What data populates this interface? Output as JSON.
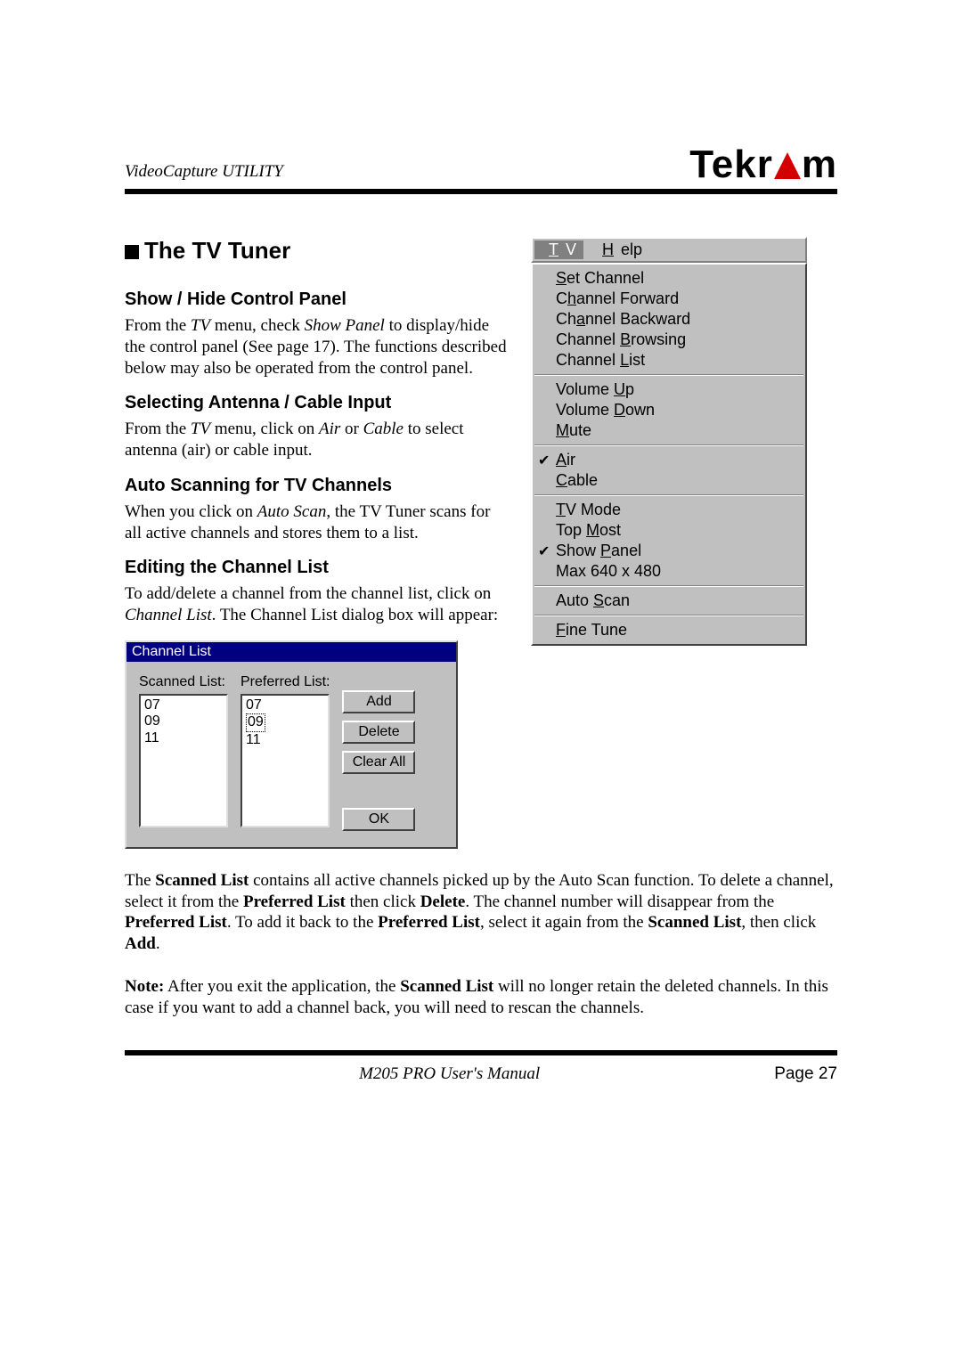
{
  "header": {
    "caption": "VideoCapture UTILITY",
    "brand_left": "Tekr",
    "brand_right": "m"
  },
  "section": {
    "title": "The TV Tuner"
  },
  "sub": {
    "showhide": {
      "h": "Show / Hide Control Panel",
      "p1a": "From the ",
      "p1b": "TV",
      "p1c": " menu, check  ",
      "p1d": "Show Panel",
      "p1e": " to display/hide the control panel (See page 17). The functions described below may also be operated from the control panel."
    },
    "ant": {
      "h": "Selecting Antenna / Cable Input",
      "p1a": "From the ",
      "p1b": "TV",
      "p1c": " menu, click on ",
      "p1d": "Air",
      "p1e": " or ",
      "p1f": "Cable",
      "p1g": " to select antenna (air) or cable input."
    },
    "scan": {
      "h": "Auto Scanning for TV Channels",
      "p1a": "When you click on ",
      "p1b": "Auto Scan",
      "p1c": ", the TV Tuner scans for all active channels and stores them to a list."
    },
    "edit": {
      "h": "Editing the Channel List",
      "p1a": "To add/delete a channel from the channel list, click on ",
      "p1b": "Channel List",
      "p1c": ". The Channel List dialog box will appear:"
    }
  },
  "menu": {
    "bar": {
      "tv": "TV",
      "help": "Help"
    },
    "items": {
      "set_channel": "Set Channel",
      "ch_forward": "Channel Forward",
      "ch_backward": "Channel Backward",
      "ch_browsing": "Channel Browsing",
      "ch_list": "Channel List",
      "vol_up": "Volume Up",
      "vol_down": "Volume Down",
      "mute": "Mute",
      "air": "Air",
      "cable": "Cable",
      "tv_mode": "TV Mode",
      "top_most": "Top Most",
      "show_panel": "Show Panel",
      "max_res": "Max 640 x 480",
      "auto_scan": "Auto Scan",
      "fine_tune": "Fine Tune"
    }
  },
  "dialog": {
    "title": "Channel List",
    "scanned_label": "Scanned List:",
    "preferred_label": "Preferred List:",
    "scanned": [
      "07",
      "09",
      "11"
    ],
    "preferred": [
      "07",
      "09",
      "11"
    ],
    "buttons": {
      "add": "Add",
      "delete": "Delete",
      "clear": "Clear All",
      "ok": "OK"
    }
  },
  "lower1": {
    "a": "The ",
    "b": "Scanned List",
    "c": " contains all active channels picked up by the Auto Scan function. To delete a channel, select it from the ",
    "d": "Preferred List",
    "e": " then click ",
    "f": "Delete",
    "g": ". The channel number will disappear from the ",
    "h": "Preferred List",
    "i": ". To add it back to the ",
    "j": "Preferred List",
    "k": ", select it again from the ",
    "l": "Scanned List",
    "m": ", then click ",
    "n": "Add",
    "o": "."
  },
  "lower2": {
    "a": "Note:",
    "b": " After you exit the application, the ",
    "c": "Scanned List",
    "d": " will no longer retain the deleted channels. In this case if you want to add a channel back, you will need to rescan the channels."
  },
  "footer": {
    "manual": "M205 PRO User's Manual",
    "page": "Page 27"
  }
}
